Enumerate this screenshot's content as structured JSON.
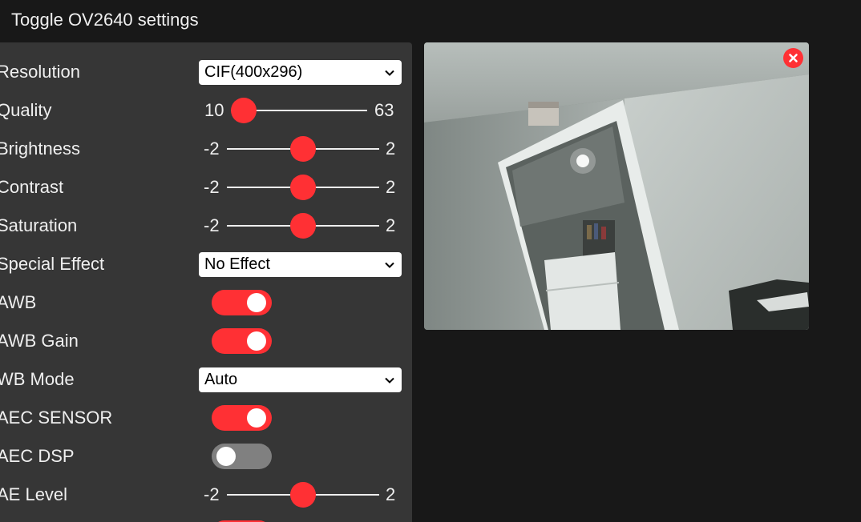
{
  "title": "Toggle OV2640 settings",
  "colors": {
    "page_background": "#181818",
    "panel_background": "#363636",
    "accent": "#ff3034",
    "toggle_off": "#808080",
    "text": "#efefef"
  },
  "settings": {
    "resolution": {
      "label": "Resolution",
      "value": "CIF(400x296)"
    },
    "quality": {
      "label": "Quality",
      "min": "10",
      "max": "63",
      "value": 10
    },
    "brightness": {
      "label": "Brightness",
      "min": "-2",
      "max": "2",
      "value": 0
    },
    "contrast": {
      "label": "Contrast",
      "min": "-2",
      "max": "2",
      "value": 0
    },
    "saturation": {
      "label": "Saturation",
      "min": "-2",
      "max": "2",
      "value": 0
    },
    "special_effect": {
      "label": "Special Effect",
      "value": "No Effect"
    },
    "awb": {
      "label": "AWB",
      "on": true
    },
    "awb_gain": {
      "label": "AWB Gain",
      "on": true
    },
    "wb_mode": {
      "label": "WB Mode",
      "value": "Auto"
    },
    "aec_sensor": {
      "label": "AEC SENSOR",
      "on": true
    },
    "aec_dsp": {
      "label": "AEC DSP",
      "on": false
    },
    "ae_level": {
      "label": "AE Level",
      "min": "-2",
      "max": "2",
      "value": 0
    }
  },
  "icons": {
    "select_arrow": "chevron-down-icon",
    "close": "close-icon"
  }
}
